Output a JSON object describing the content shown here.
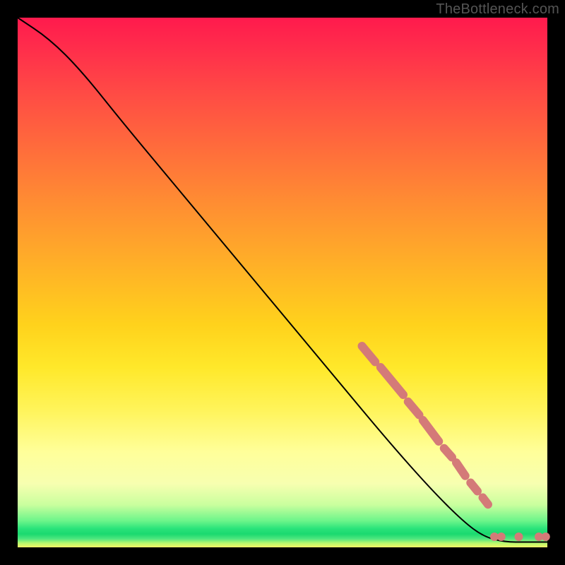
{
  "watermark": "TheBottleneck.com",
  "colors": {
    "dot": "#d47a78",
    "curve": "#000000",
    "frame_bg": "#000000"
  },
  "chart_data": {
    "type": "line",
    "title": "",
    "xlabel": "",
    "ylabel": "",
    "xlim": [
      0,
      100
    ],
    "ylim": [
      0,
      100
    ],
    "grid": false,
    "legend": false,
    "curve_points": [
      {
        "x": 0,
        "y": 100
      },
      {
        "x": 6,
        "y": 96
      },
      {
        "x": 12,
        "y": 90
      },
      {
        "x": 20,
        "y": 80
      },
      {
        "x": 30,
        "y": 68
      },
      {
        "x": 40,
        "y": 56
      },
      {
        "x": 50,
        "y": 44
      },
      {
        "x": 60,
        "y": 32
      },
      {
        "x": 70,
        "y": 20
      },
      {
        "x": 78,
        "y": 11
      },
      {
        "x": 84,
        "y": 5
      },
      {
        "x": 88,
        "y": 2
      },
      {
        "x": 92,
        "y": 1
      },
      {
        "x": 96,
        "y": 1
      },
      {
        "x": 100,
        "y": 1
      }
    ],
    "dot_segments": [
      {
        "x1": 65.0,
        "y1": 38.0,
        "x2": 67.5,
        "y2": 35.0
      },
      {
        "x1": 68.5,
        "y1": 34.0,
        "x2": 72.8,
        "y2": 28.8
      },
      {
        "x1": 73.7,
        "y1": 27.5,
        "x2": 75.8,
        "y2": 25.0
      },
      {
        "x1": 76.5,
        "y1": 24.0,
        "x2": 79.5,
        "y2": 20.0
      },
      {
        "x1": 80.5,
        "y1": 18.7,
        "x2": 82.0,
        "y2": 17.0
      },
      {
        "x1": 82.8,
        "y1": 16.0,
        "x2": 84.5,
        "y2": 13.5
      },
      {
        "x1": 85.5,
        "y1": 12.2,
        "x2": 86.8,
        "y2": 10.6
      },
      {
        "x1": 87.8,
        "y1": 9.4,
        "x2": 88.8,
        "y2": 8.1
      }
    ],
    "dot_points": [
      {
        "x": 90.0,
        "y": 2.0
      },
      {
        "x": 91.3,
        "y": 2.0
      },
      {
        "x": 94.6,
        "y": 2.0
      },
      {
        "x": 98.4,
        "y": 2.0
      },
      {
        "x": 99.7,
        "y": 2.0
      }
    ]
  }
}
